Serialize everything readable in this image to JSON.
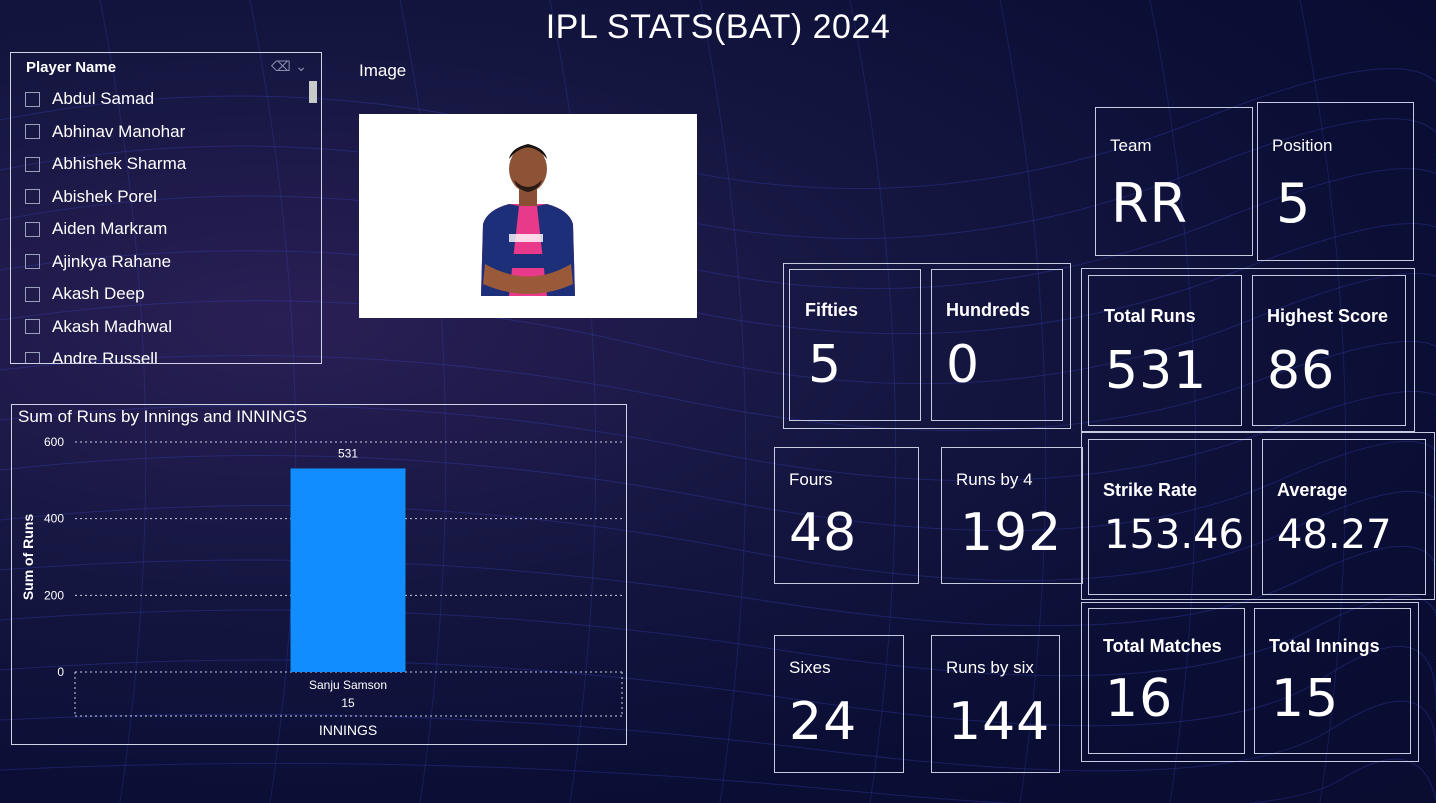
{
  "title": "IPL STATS(BAT) 2024",
  "slicer": {
    "header": "Player Name",
    "items": [
      "Abdul Samad",
      "Abhinav Manohar",
      "Abhishek Sharma",
      "Abishek Porel",
      "Aiden Markram",
      "Ajinkya Rahane",
      "Akash Deep",
      "Akash Madhwal",
      "Andre Russell"
    ]
  },
  "image_visual": {
    "label": "Image"
  },
  "chart_data": {
    "type": "bar",
    "title": "Sum of Runs by Innings and INNINGS",
    "xlabel": "INNINGS",
    "ylabel": "Sum of Runs",
    "categories": [
      "Sanju Samson"
    ],
    "sub_categories": [
      "15"
    ],
    "values": [
      531
    ],
    "data_labels": [
      "531"
    ],
    "yticks": [
      "0",
      "200",
      "400",
      "600"
    ],
    "ylim": [
      0,
      600
    ],
    "grid": true,
    "bar_color": "#118DFF"
  },
  "cards": {
    "team": {
      "label": "Team",
      "value": "RR"
    },
    "position": {
      "label": "Position",
      "value": "5"
    },
    "fifties": {
      "label": "Fifties",
      "value": "5"
    },
    "hundreds": {
      "label": "Hundreds",
      "value": "0"
    },
    "total_runs": {
      "label": "Total Runs",
      "value": "531"
    },
    "highest_score": {
      "label": "Highest Score",
      "value": "86"
    },
    "fours": {
      "label": "Fours",
      "value": "48"
    },
    "runs_by_4": {
      "label": "Runs by 4",
      "value": "192"
    },
    "strike_rate": {
      "label": "Strike Rate",
      "value": "153.46"
    },
    "average": {
      "label": "Average",
      "value": "48.27"
    },
    "sixes": {
      "label": "Sixes",
      "value": "24"
    },
    "runs_by_six": {
      "label": "Runs by six",
      "value": "144"
    },
    "total_matches": {
      "label": "Total Matches",
      "value": "16"
    },
    "total_innings": {
      "label": "Total Innings",
      "value": "15"
    }
  }
}
